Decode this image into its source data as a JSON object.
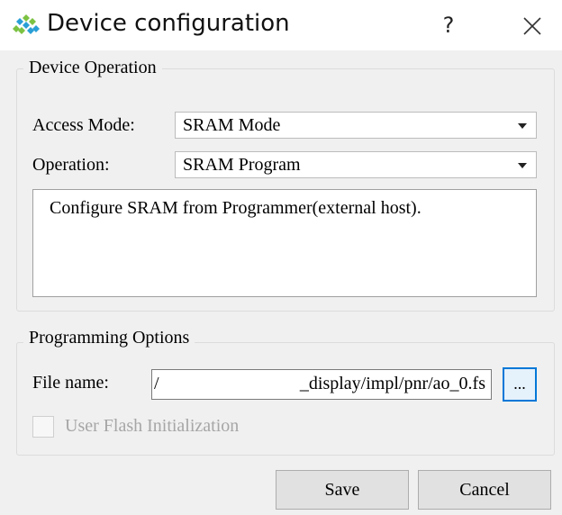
{
  "window": {
    "title": "Device configuration",
    "help_label": "?",
    "icon": "app-logo-icon",
    "close_icon": "close-icon"
  },
  "device_operation": {
    "group_title": "Device Operation",
    "access_mode_label": "Access Mode:",
    "access_mode_value": "SRAM Mode",
    "operation_label": "Operation:",
    "operation_value": "SRAM Program",
    "description": "Configure SRAM from Programmer(external host)."
  },
  "programming_options": {
    "group_title": "Programming Options",
    "file_name_label": "File name:",
    "file_name_value_start": "/",
    "file_name_value_end": "_display/impl/pnr/ao_0.fs",
    "browse_label": "...",
    "user_flash_label": "User Flash Initialization",
    "user_flash_checked": false,
    "user_flash_enabled": false
  },
  "buttons": {
    "save_label": "Save",
    "cancel_label": "Cancel"
  },
  "colors": {
    "accent": "#0078d7",
    "background": "#f0f0f0",
    "disabled_text": "#a6a6a6"
  }
}
